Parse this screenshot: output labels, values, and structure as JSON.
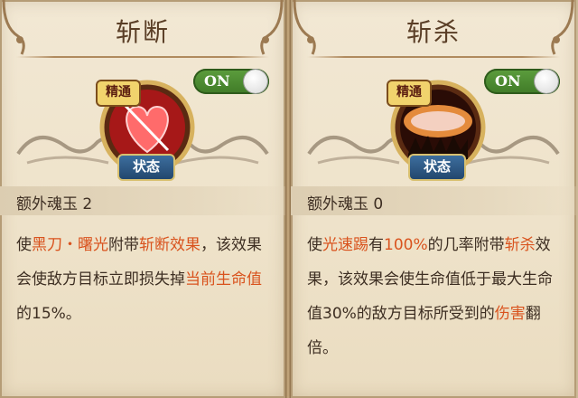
{
  "cards": [
    {
      "title": "斩断",
      "toggle": "ON",
      "badge_top": "精通",
      "badge_bottom": "状态",
      "stat": "额外魂玉 2",
      "desc": [
        {
          "text": "使",
          "hl": false
        },
        {
          "text": "黑刀・曙光",
          "hl": true
        },
        {
          "text": "附带",
          "hl": false
        },
        {
          "text": "斩断效果",
          "hl": true
        },
        {
          "text": "，该效果会使敌方目标立即损失掉",
          "hl": false
        },
        {
          "text": "当前生命值",
          "hl": true
        },
        {
          "text": "的15%。",
          "hl": false
        }
      ]
    },
    {
      "title": "斩杀",
      "toggle": "ON",
      "badge_top": "精通",
      "badge_bottom": "状态",
      "stat": "额外魂玉 0",
      "desc": [
        {
          "text": "使",
          "hl": false
        },
        {
          "text": "光速踢",
          "hl": true
        },
        {
          "text": "有",
          "hl": false
        },
        {
          "text": "100%",
          "hl": true
        },
        {
          "text": "的几率附带",
          "hl": false
        },
        {
          "text": "斩杀",
          "hl": true
        },
        {
          "text": "效果，该效果会使生命值低于最大生命值30%的敌方目标所受到的",
          "hl": false
        },
        {
          "text": "伤害",
          "hl": true
        },
        {
          "text": "翻倍。",
          "hl": false
        }
      ]
    }
  ],
  "colors": {
    "highlight": "#d9531e",
    "text": "#3d2e22",
    "toggle_green": "#4f8c31",
    "title": "#5a3e26"
  }
}
